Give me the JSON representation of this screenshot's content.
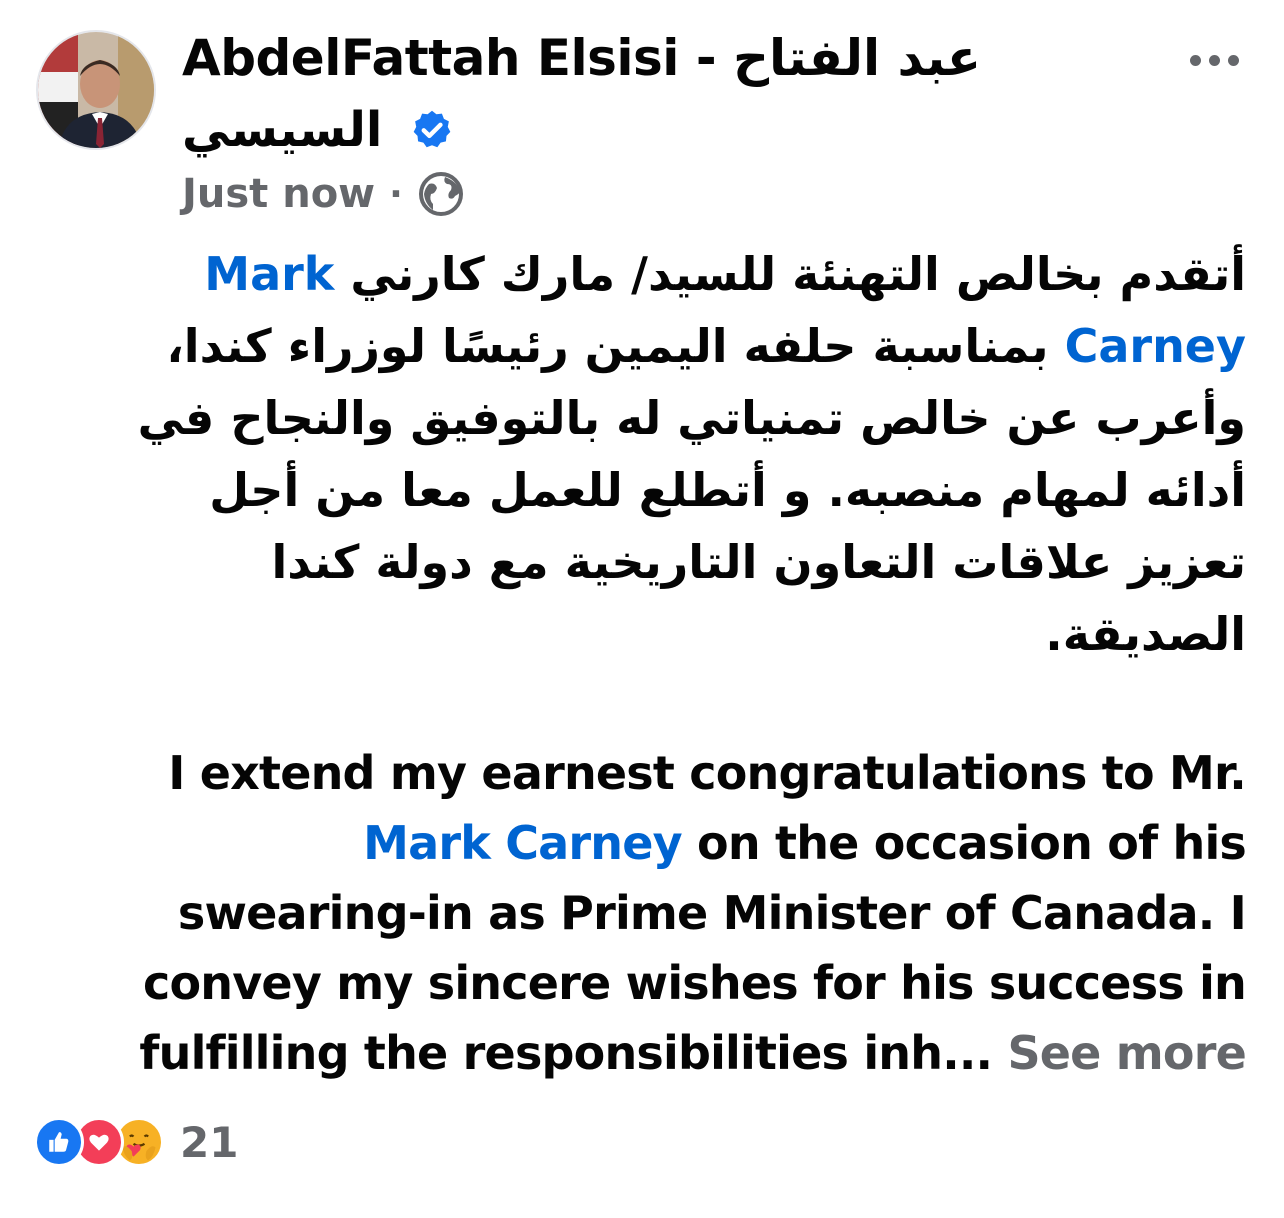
{
  "post": {
    "author_line1": "AbdelFattah Elsisi - عبد  الفتاح",
    "author_line2": "السيسي",
    "timestamp": "Just now",
    "separator": "·",
    "privacy_icon": "globe-icon",
    "arabic_text": {
      "line1_prefix": "أتقدم بخالص التهنئة للسيد/ مارك كارني",
      "line1_link": "Mark",
      "line2_link": "Carney",
      "line2_suffix": "بمناسبة حلفه اليمين رئيسًا لوزراء كندا،",
      "line3": "وأعرب عن خالص تمنياتي له بالتوفيق والنجاح في",
      "line4": "أدائه لمهام منصبه. و أتطلع للعمل معا من أجل",
      "line5": "تعزيز علاقات التعاون التاريخية مع دولة كندا",
      "line6": "الصديقة."
    },
    "english_text": {
      "line1": "I extend my earnest congratulations to Mr.",
      "line2_link": "Mark Carney",
      "line2_suffix": " on the occasion of his",
      "line3": "swearing-in as Prime Minister of Canada. I",
      "line4": "convey my sincere wishes for his success in",
      "line5": "fulfilling the responsibilities inh...",
      "see_more": "See more"
    },
    "reactions": {
      "icons": [
        "like-icon",
        "love-icon",
        "care-icon"
      ],
      "count": "21"
    }
  },
  "colors": {
    "link": "#0064d1",
    "secondary_text": "#65676b",
    "verified": "#1877f2"
  }
}
